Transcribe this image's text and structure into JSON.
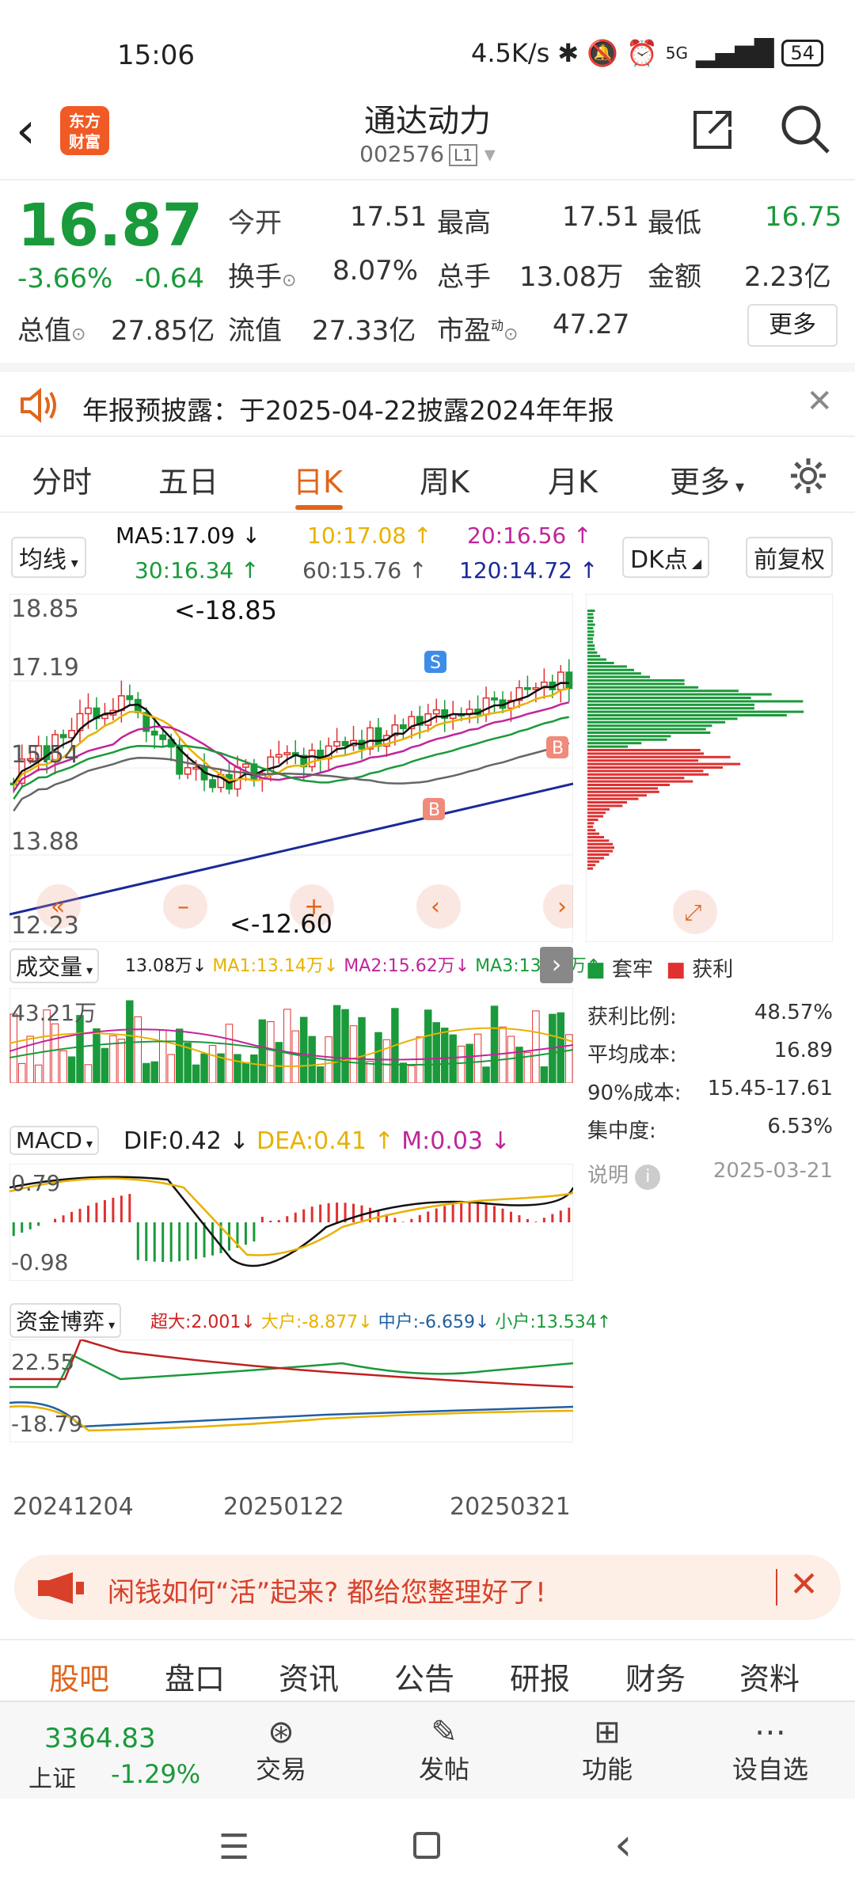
{
  "status": {
    "time": "15:06",
    "speed": "4.5K/s",
    "net": "5G",
    "battery": "54"
  },
  "header": {
    "back": "‹",
    "logo": "东方\n财富",
    "title": "通达动力",
    "code": "002576",
    "level": "L1"
  },
  "quote": {
    "price": "16.87",
    "pct": "-3.66%",
    "chg": "-0.64",
    "open_l": "今开",
    "open": "17.51",
    "high_l": "最高",
    "high": "17.51",
    "low_l": "最低",
    "low": "16.75",
    "turn_l": "换手",
    "turn": "8.07%",
    "vol_l": "总手",
    "vol": "13.08万",
    "amt_l": "金额",
    "amt": "2.23亿",
    "mcap_l": "总值",
    "mcap": "27.85亿",
    "float_l": "流值",
    "float": "27.33亿",
    "pe_l": "市盈",
    "pe_sup": "动",
    "pe": "47.27",
    "more": "更多"
  },
  "notice": {
    "text": "年报预披露：于2025-04-22披露2024年年报",
    "close": "✕"
  },
  "tabs": [
    "分时",
    "五日",
    "日K",
    "周K",
    "月K",
    "更多"
  ],
  "chart": {
    "ma_select": "均线",
    "dk": "DK点",
    "adj": "前复权",
    "ma5": "MA5:17.09",
    "ma10": "10:17.08",
    "ma20": "20:16.56",
    "ma30": "30:16.34",
    "ma60": "60:15.76",
    "ma120": "120:14.72",
    "ticks": [
      "18.85",
      "17.19",
      "15.54",
      "13.88",
      "12.23"
    ],
    "max_label": "<-18.85",
    "min_label": "<-12.60",
    "vol_select": "成交量",
    "vol_v": "13.08万",
    "vol_ma1": "MA1:13.14万",
    "vol_ma2": "MA2:15.62万",
    "vol_ma3": "MA3:13.04万",
    "vol_tick": "43.21万",
    "macd_select": "MACD",
    "dif": "DIF:0.42",
    "dea": "DEA:0.41",
    "m": "M:0.03",
    "macd_top": "0.79",
    "macd_bot": "-0.98",
    "fund_select": "资金博弈",
    "f1": "超大:2.001",
    "f2": "大户:-8.877",
    "f3": "中户:-6.659",
    "f4": "小户:13.534",
    "fund_top": "22.55",
    "fund_bot": "-18.79",
    "dates": [
      "20241204",
      "20250122",
      "20250321"
    ]
  },
  "chip": {
    "leg1": "套牢",
    "leg2": "获利",
    "rows": [
      {
        "k": "获利比例:",
        "v": "48.57%"
      },
      {
        "k": "平均成本:",
        "v": "16.89"
      },
      {
        "k": "90%成本:",
        "v": "15.45-17.61"
      },
      {
        "k": "集中度:",
        "v": "6.53%"
      }
    ],
    "note": "说明",
    "date": "2025-03-21"
  },
  "promo": {
    "text": "闲钱如何“活”起来? 都给您整理好了!"
  },
  "subtabs": [
    "股吧",
    "盘口",
    "资讯",
    "公告",
    "研报",
    "财务",
    "资料"
  ],
  "bottom": {
    "index": "3364.83",
    "index_name": "上证",
    "index_pct": "-1.29%",
    "b1": "交易",
    "b2": "发帖",
    "b3": "功能",
    "b4": "设自选"
  },
  "colors": {
    "up": "#e03030",
    "down": "#1a9a3a",
    "accent": "#e0651c"
  }
}
